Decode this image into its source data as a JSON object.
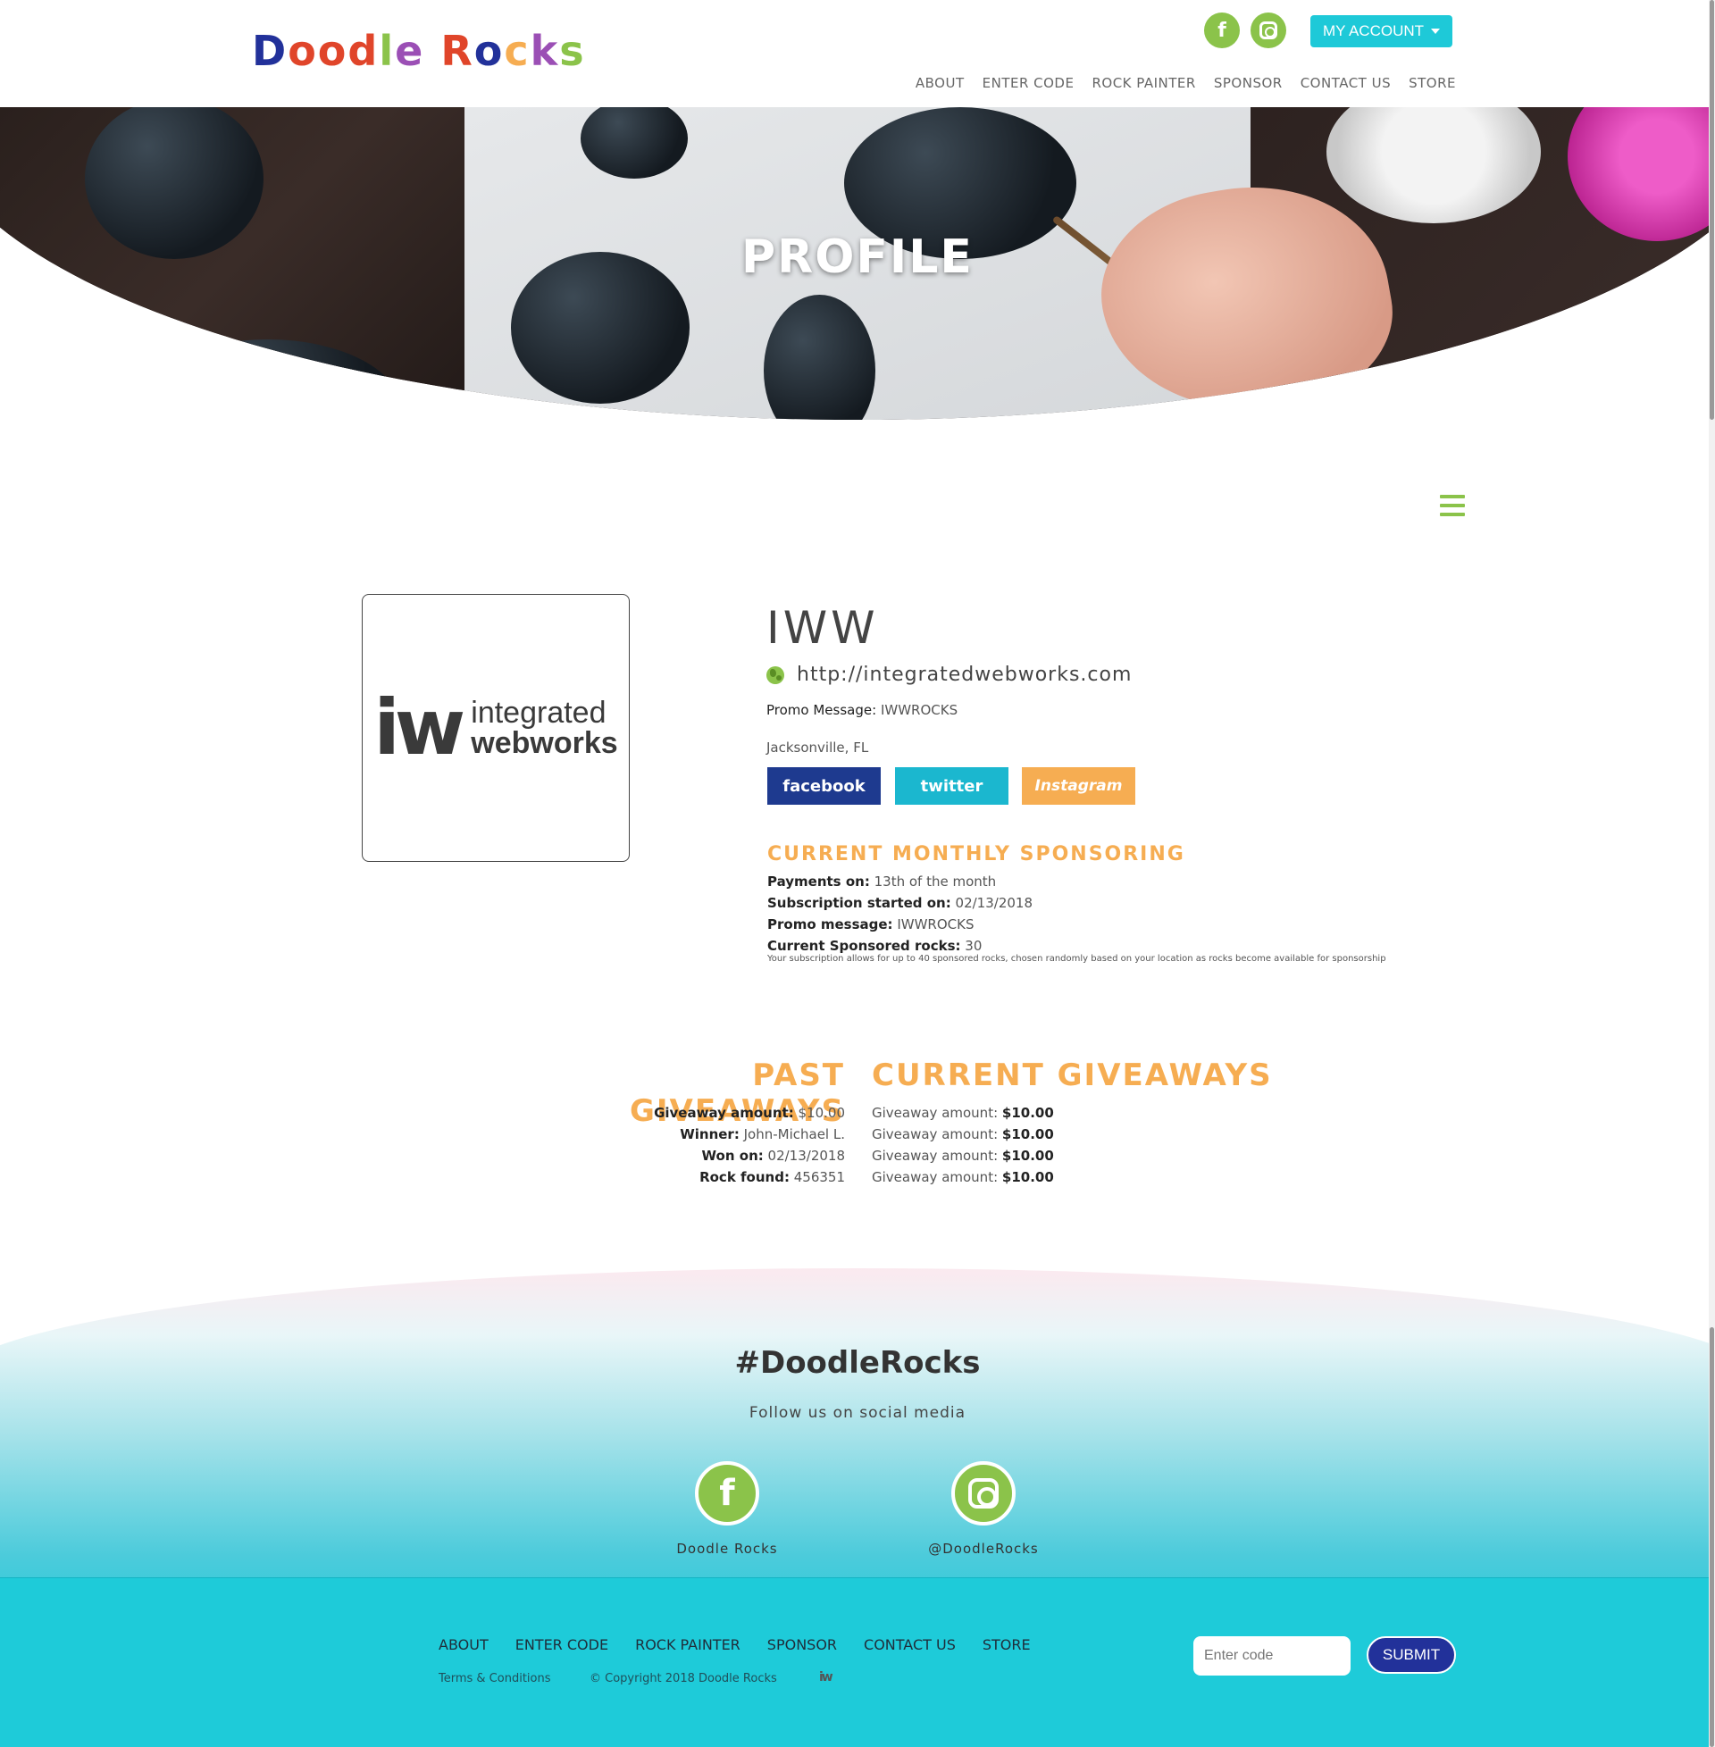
{
  "brand": {
    "logo_letters": [
      {
        "ch": "D",
        "color": "#22319a"
      },
      {
        "ch": "o",
        "color": "#e0452a"
      },
      {
        "ch": "o",
        "color": "#e0452a"
      },
      {
        "ch": "d",
        "color": "#e0452a"
      },
      {
        "ch": "l",
        "color": "#8bc34a"
      },
      {
        "ch": "e",
        "color": "#9b4fb5"
      },
      {
        "ch": " ",
        "color": "#ffffff"
      },
      {
        "ch": "R",
        "color": "#e0452a"
      },
      {
        "ch": "o",
        "color": "#22319a"
      },
      {
        "ch": "c",
        "color": "#f6ad52"
      },
      {
        "ch": "k",
        "color": "#9b4fb5"
      },
      {
        "ch": "s",
        "color": "#8bc34a"
      }
    ]
  },
  "header": {
    "account_label": "MY ACCOUNT",
    "nav": [
      "ABOUT",
      "ENTER CODE",
      "ROCK PAINTER",
      "SPONSOR",
      "CONTACT US",
      "STORE"
    ]
  },
  "hero": {
    "title": "PROFILE"
  },
  "profile": {
    "logo_line1": "integrated",
    "logo_line2": "webworks",
    "logo_mark": "iw",
    "name": "IWW",
    "url": "http://integratedwebworks.com",
    "promo_label": "Promo Message:",
    "promo_value": "IWWROCKS",
    "location": "Jacksonville, FL",
    "social": {
      "facebook": "facebook",
      "twitter": "twitter",
      "instagram": "Instagram"
    }
  },
  "sponsoring": {
    "heading": "CURRENT MONTHLY SPONSORING",
    "rows": [
      {
        "label": "Payments on:",
        "value": "13th of the month"
      },
      {
        "label": "Subscription started on:",
        "value": "02/13/2018"
      },
      {
        "label": "Promo message:",
        "value": "IWWROCKS"
      },
      {
        "label": "Current Sponsored rocks:",
        "value": "30"
      }
    ],
    "note": "Your subscription allows for up to 40 sponsored rocks, chosen randomly based on your location as rocks become available for sponsorship"
  },
  "past_giveaways": {
    "heading": "PAST GIVEAWAYS",
    "rows": [
      {
        "label": "Giveaway amount:",
        "value": "$10.00"
      },
      {
        "label": "Winner:",
        "value": "John-Michael L."
      },
      {
        "label": "Won on:",
        "value": "02/13/2018"
      },
      {
        "label": "Rock found:",
        "value": "456351"
      }
    ]
  },
  "current_giveaways": {
    "heading": "CURRENT GIVEAWAYS",
    "rows": [
      {
        "label": "Giveaway amount:",
        "value": "$10.00"
      },
      {
        "label": "Giveaway amount:",
        "value": "$10.00"
      },
      {
        "label": "Giveaway amount:",
        "value": "$10.00"
      },
      {
        "label": "Giveaway amount:",
        "value": "$10.00"
      }
    ]
  },
  "footer": {
    "hashtag": "#DoodleRocks",
    "follow": "Follow us on social media",
    "facebook_label": "Doodle Rocks",
    "instagram_label": "@DoodleRocks",
    "nav": [
      "ABOUT",
      "ENTER CODE",
      "ROCK PAINTER",
      "SPONSOR",
      "CONTACT US",
      "STORE"
    ],
    "terms": "Terms & Conditions",
    "copyright": "© Copyright 2018 Doodle Rocks",
    "iw_mark": "iw",
    "code_placeholder": "Enter code",
    "submit_label": "SUBMIT"
  },
  "colors": {
    "accent_green": "#8bc34a",
    "accent_teal": "#1ecbd9",
    "accent_orange": "#f6ad52",
    "navy": "#22319a"
  }
}
